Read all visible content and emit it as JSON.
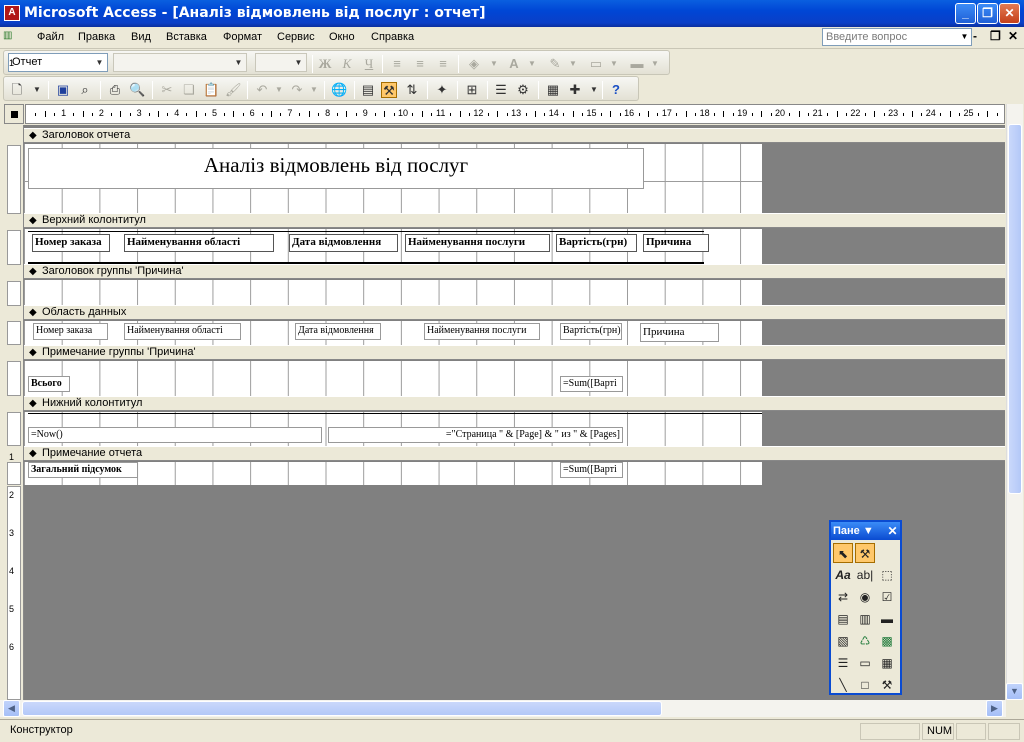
{
  "app": {
    "title": "Microsoft Access - [Аналіз відмовлень від послуг : отчет]"
  },
  "menu": {
    "items": [
      "Файл",
      "Правка",
      "Вид",
      "Вставка",
      "Формат",
      "Сервис",
      "Окно",
      "Справка"
    ],
    "help_placeholder": "Введите вопрос"
  },
  "toolbar": {
    "object_combo": "Отчет",
    "font_combo": "",
    "size_combo": ""
  },
  "ruler": {
    "h_numbers": [
      "1",
      "2",
      "3",
      "4",
      "5",
      "6",
      "7",
      "8",
      "9",
      "10",
      "11",
      "12",
      "13",
      "14",
      "15",
      "16",
      "17",
      "18",
      "19",
      "20",
      "21",
      "22",
      "23",
      "24",
      "25"
    ],
    "v_numbers": [
      "1",
      "1",
      "1",
      "1",
      "2",
      "3",
      "4",
      "5",
      "6"
    ]
  },
  "sections": {
    "report_header": "Заголовок отчета",
    "page_header": "Верхний колонтитул",
    "group_header": "Заголовок группы 'Причина'",
    "detail": "Область данных",
    "group_footer": "Примечание группы 'Причина'",
    "page_footer": "Нижний колонтитул",
    "report_footer": "Примечание отчета"
  },
  "report": {
    "title": "Аналіз відмовлень від послуг",
    "headers": [
      "Номер заказа",
      "Найменування області",
      "Дата відмовлення",
      "Найменування послуги",
      "Вартість(грн)",
      "Причина"
    ],
    "detail_fields": [
      "Номер заказа",
      "Найменування області",
      "Дата відмовлення",
      "Найменування послуги",
      "Вартість(грн)",
      "Причина"
    ],
    "group_total_label": "Всього",
    "group_total_expr": "=Sum([Варті",
    "page_footer_now": "=Now()",
    "page_footer_page": "=\"Страница \" & [Page] & \" из \" & [Pages]",
    "report_total_label": "Загальний підсумок",
    "report_total_expr": "=Sum([Варті"
  },
  "toolbox": {
    "title": "Пане"
  },
  "status": {
    "mode": "Конструктор",
    "num": "NUM"
  }
}
